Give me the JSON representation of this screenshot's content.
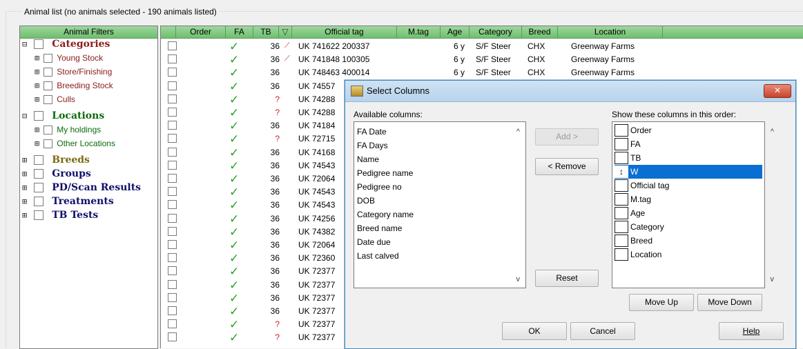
{
  "group_title": "Animal list (no animals selected - 190 animals listed)",
  "filters": {
    "header": "Animal Filters",
    "tree": [
      {
        "label": "Categories",
        "level": 0,
        "expander": "⊟",
        "bold": true,
        "color": "#8b1a1a"
      },
      {
        "label": "Young Stock",
        "level": 1,
        "expander": "⊞",
        "bold": false,
        "color": "#8b1a1a"
      },
      {
        "label": "Store/Finishing",
        "level": 1,
        "expander": "⊞",
        "bold": false,
        "color": "#8b1a1a"
      },
      {
        "label": "Breeding Stock",
        "level": 1,
        "expander": "⊞",
        "bold": false,
        "color": "#8b1a1a"
      },
      {
        "label": "Culls",
        "level": 1,
        "expander": "⊞",
        "bold": false,
        "color": "#8b1a1a"
      },
      {
        "label": "Locations",
        "level": 0,
        "expander": "⊟",
        "bold": true,
        "color": "#0a6a0a"
      },
      {
        "label": "My holdings",
        "level": 1,
        "expander": "⊞",
        "bold": false,
        "color": "#0a6a0a"
      },
      {
        "label": "Other Locations",
        "level": 1,
        "expander": "⊞",
        "bold": false,
        "color": "#0a6a0a"
      },
      {
        "label": "Breeds",
        "level": 0,
        "expander": "⊞",
        "bold": true,
        "color": "#7a6a10"
      },
      {
        "label": "Groups",
        "level": 0,
        "expander": "⊞",
        "bold": true,
        "color": "#10106a"
      },
      {
        "label": "PD/Scan Results",
        "level": 0,
        "expander": "⊞",
        "bold": true,
        "color": "#10106a"
      },
      {
        "label": "Treatments",
        "level": 0,
        "expander": "⊞",
        "bold": true,
        "color": "#10106a"
      },
      {
        "label": "TB Tests",
        "level": 0,
        "expander": "⊞",
        "bold": true,
        "color": "#10106a"
      }
    ]
  },
  "grid": {
    "headers": [
      "Order",
      "FA",
      "TB",
      "▽",
      "Official tag",
      "M.tag",
      "Age",
      "Category",
      "Breed",
      "Location"
    ],
    "rows": [
      {
        "fa": "✓",
        "tb": "36",
        "tag_icon": true,
        "official": "UK 741622 200337",
        "age": "6 y",
        "category": "S/F Steer",
        "breed": "CHX",
        "location": "Greenway Farms"
      },
      {
        "fa": "✓",
        "tb": "36",
        "tag_icon": true,
        "official": "UK 741848 100305",
        "age": "6 y",
        "category": "S/F Steer",
        "breed": "CHX",
        "location": "Greenway Farms"
      },
      {
        "fa": "✓",
        "tb": "36",
        "tag_icon": false,
        "official": "UK 748463 400014",
        "age": "6 y",
        "category": "S/F Steer",
        "breed": "CHX",
        "location": "Greenway Farms"
      },
      {
        "fa": "✓",
        "tb": "36",
        "tag_icon": false,
        "official": "UK 74557",
        "age": "",
        "category": "",
        "breed": "",
        "location": ""
      },
      {
        "fa": "✓",
        "tb": "?",
        "tag_icon": false,
        "official": "UK 74288",
        "age": "",
        "category": "",
        "breed": "",
        "location": ""
      },
      {
        "fa": "✓",
        "tb": "?",
        "tag_icon": false,
        "official": "UK 74288",
        "age": "",
        "category": "",
        "breed": "",
        "location": ""
      },
      {
        "fa": "✓",
        "tb": "36",
        "tag_icon": false,
        "official": "UK 74184",
        "age": "",
        "category": "",
        "breed": "",
        "location": ""
      },
      {
        "fa": "✓",
        "tb": "?",
        "tag_icon": false,
        "official": "UK 72715",
        "age": "",
        "category": "",
        "breed": "",
        "location": ""
      },
      {
        "fa": "✓",
        "tb": "36",
        "tag_icon": false,
        "official": "UK 74168",
        "age": "",
        "category": "",
        "breed": "",
        "location": ""
      },
      {
        "fa": "✓",
        "tb": "36",
        "tag_icon": false,
        "official": "UK 74543",
        "age": "",
        "category": "",
        "breed": "",
        "location": ""
      },
      {
        "fa": "✓",
        "tb": "36",
        "tag_icon": false,
        "official": "UK 72064",
        "age": "",
        "category": "",
        "breed": "",
        "location": ""
      },
      {
        "fa": "✓",
        "tb": "36",
        "tag_icon": false,
        "official": "UK 74543",
        "age": "",
        "category": "",
        "breed": "",
        "location": ""
      },
      {
        "fa": "✓",
        "tb": "36",
        "tag_icon": false,
        "official": "UK 74543",
        "age": "",
        "category": "",
        "breed": "",
        "location": ""
      },
      {
        "fa": "✓",
        "tb": "36",
        "tag_icon": false,
        "official": "UK 74256",
        "age": "",
        "category": "",
        "breed": "",
        "location": ""
      },
      {
        "fa": "✓",
        "tb": "36",
        "tag_icon": false,
        "official": "UK 74382",
        "age": "",
        "category": "",
        "breed": "",
        "location": ""
      },
      {
        "fa": "✓",
        "tb": "36",
        "tag_icon": false,
        "official": "UK 72064",
        "age": "",
        "category": "",
        "breed": "",
        "location": ""
      },
      {
        "fa": "✓",
        "tb": "36",
        "tag_icon": false,
        "official": "UK 72360",
        "age": "",
        "category": "",
        "breed": "",
        "location": ""
      },
      {
        "fa": "✓",
        "tb": "36",
        "tag_icon": false,
        "official": "UK 72377",
        "age": "",
        "category": "",
        "breed": "",
        "location": ""
      },
      {
        "fa": "✓",
        "tb": "36",
        "tag_icon": false,
        "official": "UK 72377",
        "age": "",
        "category": "",
        "breed": "",
        "location": ""
      },
      {
        "fa": "✓",
        "tb": "36",
        "tag_icon": false,
        "official": "UK 72377",
        "age": "",
        "category": "",
        "breed": "",
        "location": ""
      },
      {
        "fa": "✓",
        "tb": "36",
        "tag_icon": false,
        "official": "UK 72377",
        "age": "",
        "category": "",
        "breed": "",
        "location": ""
      },
      {
        "fa": "✓",
        "tb": "?",
        "tag_icon": false,
        "official": "UK 72377",
        "age": "",
        "category": "",
        "breed": "",
        "location": ""
      },
      {
        "fa": "✓",
        "tb": "?",
        "tag_icon": false,
        "official": "UK 72377",
        "age": "",
        "category": "",
        "breed": "",
        "location": ""
      }
    ]
  },
  "dialog": {
    "title": "Select Columns",
    "close": "✕",
    "available_label": "Available columns:",
    "available": [
      "FA Date",
      "FA Days",
      "Name",
      "Pedigree name",
      "Pedigree no",
      "DOB",
      "Category name",
      "Breed name",
      "Date due",
      "Last calved"
    ],
    "show_label": "Show these columns in this order:",
    "show": [
      {
        "label": "Order",
        "selected": false,
        "mark": ""
      },
      {
        "label": "FA",
        "selected": false,
        "mark": ""
      },
      {
        "label": "TB",
        "selected": false,
        "mark": ""
      },
      {
        "label": "W",
        "selected": true,
        "mark": "↕"
      },
      {
        "label": "Official tag",
        "selected": false,
        "mark": ""
      },
      {
        "label": "M.tag",
        "selected": false,
        "mark": ""
      },
      {
        "label": "Age",
        "selected": false,
        "mark": ""
      },
      {
        "label": "Category",
        "selected": false,
        "mark": ""
      },
      {
        "label": "Breed",
        "selected": false,
        "mark": ""
      },
      {
        "label": "Location",
        "selected": false,
        "mark": ""
      }
    ],
    "buttons": {
      "add": "Add >",
      "remove": "< Remove",
      "reset": "Reset",
      "move_up": "Move Up",
      "move_down": "Move Down",
      "ok": "OK",
      "cancel": "Cancel",
      "help": "Help"
    },
    "scroll_up": "^",
    "scroll_down": "v"
  }
}
